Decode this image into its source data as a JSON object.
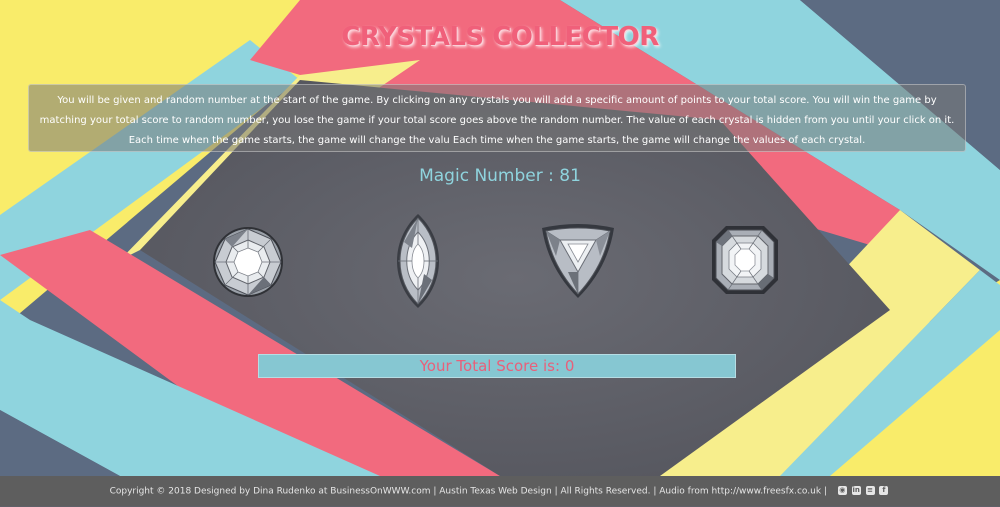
{
  "game": {
    "title": "CRYSTALS COLLECTOR",
    "instructions": "You will be given and random number at the start of the game. By clicking on any crystals you will add a specific amount of points to your total score. You will win the game by matching your total score to random number, you lose the game if your total score goes above the random number. The value of each crystal is hidden from you until your click on it. Each time when the game starts, the game will change the valu Each time when the game starts, the game will change the values of each crystal.",
    "magic_label": "Magic Number : 81",
    "score_label": "Your Total Score is: 0"
  },
  "crystals": [
    {
      "shape": "round"
    },
    {
      "shape": "marquise"
    },
    {
      "shape": "trillion"
    },
    {
      "shape": "asscher"
    }
  ],
  "footer": {
    "text": "Copyright © 2018 Designed by Dina Rudenko at BusinessOnWWW.com | Austin Texas Web Design | All Rights Reserved. | Audio from http://www.freesfx.co.uk |",
    "social_icons": [
      "github-icon",
      "linkedin-icon",
      "stackoverflow-icon",
      "facebook-icon"
    ]
  },
  "colors": {
    "yellow": "#f7ee8c",
    "bright_yellow": "#f9ec6a",
    "pink": "#f26a7e",
    "cyan": "#8fd4de",
    "slate": "#5c6b82",
    "center": "#5f6068",
    "title": "#f0607a"
  }
}
